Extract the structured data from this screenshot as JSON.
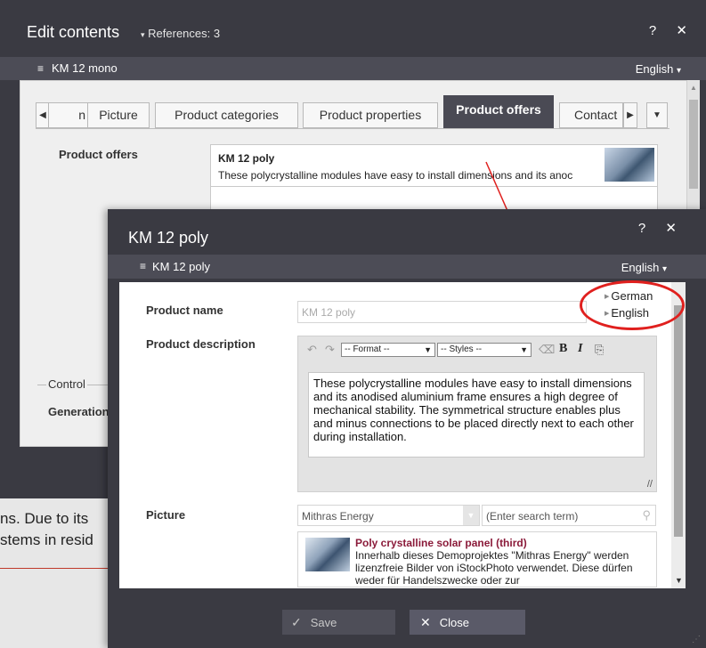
{
  "background": {
    "line1": "ns. Due to its",
    "line2": "stems in resid"
  },
  "outer": {
    "title": "Edit contents",
    "references": "References: 3",
    "controls": "? ✕",
    "item_name": "KM 12 mono",
    "language": "English",
    "tabs": [
      "n",
      "Picture",
      "Product categories",
      "Product properties",
      "Product offers",
      "Contact"
    ],
    "field_label": "Product offers",
    "offer_title": "KM 12 poly",
    "offer_desc": "These polycrystalline modules have easy to install dimensions and its anoc",
    "control_legend": "Control",
    "generation_label": "Generation"
  },
  "inner": {
    "title": "KM 12 poly",
    "controls": "? ✕",
    "item_name": "KM 12 poly",
    "language": "English",
    "product_name_label": "Product name",
    "product_name_value": "KM 12 poly",
    "product_description_label": "Product description",
    "format_select": "-- Format --",
    "styles_select": "-- Styles --",
    "description_text": "These polycrystalline modules have easy to install dimensions and its anodised aluminium frame ensures a high degree of mechanical stability. The symmetrical structure enables plus and minus connections to be placed directly next to each other during installation.",
    "picture_label": "Picture",
    "picture_source": "Mithras Energy",
    "search_placeholder": "(Enter search term)",
    "picture_title": "Poly crystalline solar panel (third)",
    "picture_desc": "Innerhalb dieses Demoprojektes \"Mithras Energy\" werden lizenzfreie Bilder von iStockPhoto verwendet. Diese dürfen weder für Handelszwecke oder zur",
    "language_options": [
      "German",
      "English"
    ],
    "save_label": "Save",
    "close_label": "Close"
  },
  "colors": {
    "annotation": "#e0201e",
    "dialog_bg": "#3a3a42",
    "picture_title": "#8b1b3a"
  }
}
